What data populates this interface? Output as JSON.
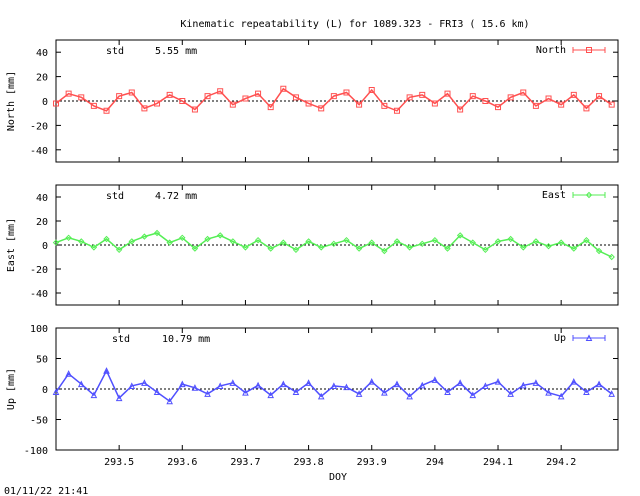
{
  "chart_data": {
    "type": "line",
    "title": "Kinematic repeatability (L) for 1089.323 - FRI3  ( 15.6 km)",
    "xlabel": "DOY",
    "timestamp": "01/11/22 21:41",
    "xlim": [
      293.4,
      294.29
    ],
    "x_ticks": [
      "293.5",
      "293.6",
      "293.7",
      "293.8",
      "293.9",
      "294",
      "294.1",
      "294.2"
    ],
    "x_tick_values": [
      293.5,
      293.6,
      293.7,
      293.8,
      293.9,
      294.0,
      294.1,
      294.2
    ],
    "panels": [
      {
        "name": "North",
        "ylabel": "North [mm]",
        "std_label": "std",
        "std_value": "5.55 mm",
        "legend": "North",
        "color": "#ff5050",
        "marker": "square",
        "ylim": [
          -50,
          50
        ],
        "y_ticks": [
          "40",
          "20",
          "0",
          "-20",
          "-40"
        ],
        "y_tick_values": [
          40,
          20,
          0,
          -20,
          -40
        ],
        "series": {
          "x": [
            293.4,
            293.42,
            293.44,
            293.46,
            293.48,
            293.5,
            293.52,
            293.54,
            293.56,
            293.58,
            293.6,
            293.62,
            293.64,
            293.66,
            293.68,
            293.7,
            293.72,
            293.74,
            293.76,
            293.78,
            293.8,
            293.82,
            293.84,
            293.86,
            293.88,
            293.9,
            293.92,
            293.94,
            293.96,
            293.98,
            294.0,
            294.02,
            294.04,
            294.06,
            294.08,
            294.1,
            294.12,
            294.14,
            294.16,
            294.18,
            294.2,
            294.22,
            294.24,
            294.26,
            294.28
          ],
          "y": [
            -2,
            6,
            3,
            -4,
            -8,
            4,
            7,
            -6,
            -2,
            5,
            0,
            -7,
            4,
            8,
            -3,
            2,
            6,
            -5,
            10,
            3,
            -2,
            -6,
            4,
            7,
            -3,
            9,
            -4,
            -8,
            3,
            5,
            -2,
            6,
            -7,
            4,
            0,
            -5,
            3,
            7,
            -4,
            2,
            -3,
            5,
            -6,
            4,
            -3
          ]
        }
      },
      {
        "name": "East",
        "ylabel": "East [mm]",
        "std_label": "std",
        "std_value": "4.72 mm",
        "legend": "East",
        "color": "#55ee55",
        "marker": "diamond",
        "ylim": [
          -50,
          50
        ],
        "y_ticks": [
          "40",
          "20",
          "0",
          "-20",
          "-40"
        ],
        "y_tick_values": [
          40,
          20,
          0,
          -20,
          -40
        ],
        "series": {
          "x": [
            293.4,
            293.42,
            293.44,
            293.46,
            293.48,
            293.5,
            293.52,
            293.54,
            293.56,
            293.58,
            293.6,
            293.62,
            293.64,
            293.66,
            293.68,
            293.7,
            293.72,
            293.74,
            293.76,
            293.78,
            293.8,
            293.82,
            293.84,
            293.86,
            293.88,
            293.9,
            293.92,
            293.94,
            293.96,
            293.98,
            294.0,
            294.02,
            294.04,
            294.06,
            294.08,
            294.1,
            294.12,
            294.14,
            294.16,
            294.18,
            294.2,
            294.22,
            294.24,
            294.26,
            294.28
          ],
          "y": [
            2,
            6,
            3,
            -2,
            5,
            -4,
            3,
            7,
            10,
            2,
            6,
            -3,
            5,
            8,
            3,
            -2,
            4,
            -3,
            2,
            -4,
            3,
            -2,
            1,
            4,
            -3,
            2,
            -5,
            3,
            -2,
            1,
            4,
            -3,
            8,
            2,
            -4,
            3,
            5,
            -2,
            3,
            -1,
            2,
            -3,
            4,
            -5,
            -10
          ]
        }
      },
      {
        "name": "Up",
        "ylabel": "Up [mm]",
        "std_label": "std",
        "std_value": "10.79 mm",
        "legend": "Up",
        "color": "#5050ff",
        "marker": "triangle",
        "ylim": [
          -100,
          100
        ],
        "y_ticks": [
          "100",
          "50",
          "0",
          "-50",
          "-100"
        ],
        "y_tick_values": [
          100,
          50,
          0,
          -50,
          -100
        ],
        "series": {
          "x": [
            293.4,
            293.42,
            293.44,
            293.46,
            293.48,
            293.5,
            293.52,
            293.54,
            293.56,
            293.58,
            293.6,
            293.62,
            293.64,
            293.66,
            293.68,
            293.7,
            293.72,
            293.74,
            293.76,
            293.78,
            293.8,
            293.82,
            293.84,
            293.86,
            293.88,
            293.9,
            293.92,
            293.94,
            293.96,
            293.98,
            294.0,
            294.02,
            294.04,
            294.06,
            294.08,
            294.1,
            294.12,
            294.14,
            294.16,
            294.18,
            294.2,
            294.22,
            294.24,
            294.26,
            294.28
          ],
          "y": [
            -5,
            25,
            8,
            -10,
            30,
            -15,
            5,
            10,
            -5,
            -20,
            8,
            2,
            -8,
            5,
            10,
            -6,
            6,
            -10,
            8,
            -5,
            10,
            -12,
            5,
            3,
            -8,
            12,
            -6,
            8,
            -12,
            6,
            15,
            -5,
            10,
            -10,
            5,
            12,
            -8,
            6,
            10,
            -6,
            -12,
            12,
            -5,
            8,
            -8
          ]
        }
      }
    ]
  }
}
